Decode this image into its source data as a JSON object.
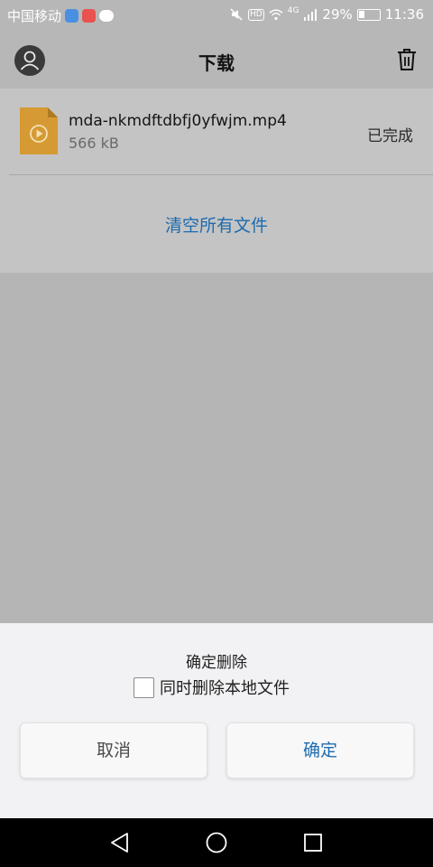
{
  "status_bar": {
    "carrier": "中国移动",
    "hd_label": "HD",
    "network_type": "4G",
    "battery_percent": "29%",
    "battery_level": 0.29,
    "time": "11:36"
  },
  "header": {
    "title": "下载",
    "avatar_icon": "user-avatar-icon",
    "action_icon": "trash-icon"
  },
  "downloads": {
    "items": [
      {
        "file_name": "mda-nkmdftdbfj0yfwjm.mp4",
        "size": "566 kB",
        "status": "已完成",
        "icon": "video-file-icon",
        "icon_color": "#d59a33"
      }
    ],
    "clear_all_label": "清空所有文件"
  },
  "dialog": {
    "title": "确定删除",
    "checkbox_label": "同时删除本地文件",
    "checkbox_checked": false,
    "cancel_label": "取消",
    "confirm_label": "确定"
  },
  "nav_bar": {
    "back_icon": "back-triangle-icon",
    "home_icon": "home-circle-icon",
    "recents_icon": "recents-square-icon"
  },
  "colors": {
    "accent": "#1d6bb0",
    "overlay": "#b5b5b5",
    "sheet_background": "#f2f2f4"
  }
}
